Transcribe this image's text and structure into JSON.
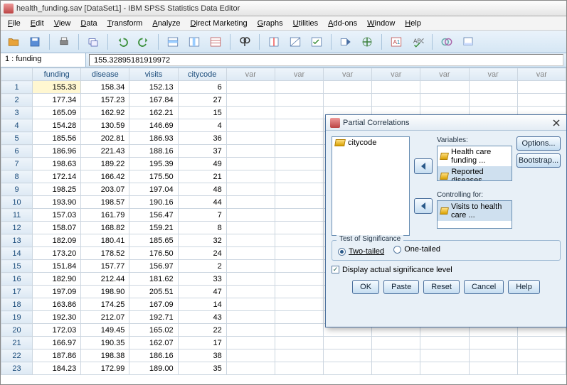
{
  "titlebar": {
    "text": "health_funding.sav [DataSet1] - IBM SPSS Statistics Data Editor"
  },
  "menus": [
    "File",
    "Edit",
    "View",
    "Data",
    "Transform",
    "Analyze",
    "Direct Marketing",
    "Graphs",
    "Utilities",
    "Add-ons",
    "Window",
    "Help"
  ],
  "cellbar": {
    "addr": "1 : funding",
    "value": "155.32895181919972"
  },
  "columns": [
    "funding",
    "disease",
    "visits",
    "citycode",
    "var",
    "var",
    "var",
    "var",
    "var",
    "var",
    "var"
  ],
  "rows": [
    {
      "n": 1,
      "c": [
        "155.33",
        "158.34",
        "152.13",
        "6"
      ]
    },
    {
      "n": 2,
      "c": [
        "177.34",
        "157.23",
        "167.84",
        "27"
      ]
    },
    {
      "n": 3,
      "c": [
        "165.09",
        "162.92",
        "162.21",
        "15"
      ]
    },
    {
      "n": 4,
      "c": [
        "154.28",
        "130.59",
        "146.69",
        "4"
      ]
    },
    {
      "n": 5,
      "c": [
        "185.56",
        "202.81",
        "186.93",
        "36"
      ]
    },
    {
      "n": 6,
      "c": [
        "186.96",
        "221.43",
        "188.16",
        "37"
      ]
    },
    {
      "n": 7,
      "c": [
        "198.63",
        "189.22",
        "195.39",
        "49"
      ]
    },
    {
      "n": 8,
      "c": [
        "172.14",
        "166.42",
        "175.50",
        "21"
      ]
    },
    {
      "n": 9,
      "c": [
        "198.25",
        "203.07",
        "197.04",
        "48"
      ]
    },
    {
      "n": 10,
      "c": [
        "193.90",
        "198.57",
        "190.16",
        "44"
      ]
    },
    {
      "n": 11,
      "c": [
        "157.03",
        "161.79",
        "156.47",
        "7"
      ]
    },
    {
      "n": 12,
      "c": [
        "158.07",
        "168.82",
        "159.21",
        "8"
      ]
    },
    {
      "n": 13,
      "c": [
        "182.09",
        "180.41",
        "185.65",
        "32"
      ]
    },
    {
      "n": 14,
      "c": [
        "173.20",
        "178.52",
        "176.50",
        "24"
      ]
    },
    {
      "n": 15,
      "c": [
        "151.84",
        "157.77",
        "156.97",
        "2"
      ]
    },
    {
      "n": 16,
      "c": [
        "182.90",
        "212.44",
        "181.62",
        "33"
      ]
    },
    {
      "n": 17,
      "c": [
        "197.09",
        "198.90",
        "205.51",
        "47"
      ]
    },
    {
      "n": 18,
      "c": [
        "163.86",
        "174.25",
        "167.09",
        "14"
      ]
    },
    {
      "n": 19,
      "c": [
        "192.30",
        "212.07",
        "192.71",
        "43"
      ]
    },
    {
      "n": 20,
      "c": [
        "172.03",
        "149.45",
        "165.02",
        "22"
      ]
    },
    {
      "n": 21,
      "c": [
        "166.97",
        "190.35",
        "162.07",
        "17"
      ]
    },
    {
      "n": 22,
      "c": [
        "187.86",
        "198.38",
        "186.16",
        "38"
      ]
    },
    {
      "n": 23,
      "c": [
        "184.23",
        "172.99",
        "189.00",
        "35"
      ]
    }
  ],
  "dialog": {
    "title": "Partial Correlations",
    "source_items": [
      "citycode"
    ],
    "variables_label": "Variables:",
    "variables": [
      "Health care funding ...",
      "Reported diseases ..."
    ],
    "controlling_label": "Controlling for:",
    "controlling": [
      "Visits to health care ..."
    ],
    "side_buttons": {
      "options": "Options...",
      "bootstrap": "Bootstrap..."
    },
    "sig_group": "Test of Significance",
    "radio_two": "Two-tailed",
    "radio_one": "One-tailed",
    "check_sig": "Display actual significance level",
    "buttons": {
      "ok": "OK",
      "paste": "Paste",
      "reset": "Reset",
      "cancel": "Cancel",
      "help": "Help"
    }
  }
}
